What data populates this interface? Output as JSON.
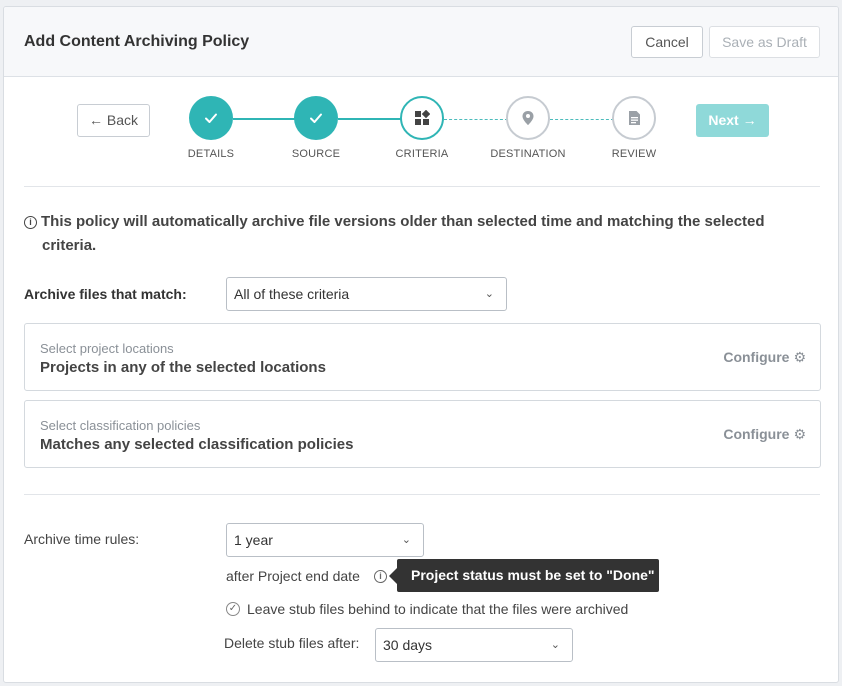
{
  "header": {
    "title": "Add Content Archiving Policy",
    "cancel_label": "Cancel",
    "draft_label": "Save as Draft"
  },
  "wizard": {
    "back_label": "← Back",
    "next_label": "Next →",
    "steps": [
      {
        "label": "DETAILS",
        "state": "done",
        "icon": "check-icon"
      },
      {
        "label": "SOURCE",
        "state": "done",
        "icon": "check-icon"
      },
      {
        "label": "CRITERIA",
        "state": "current",
        "icon": "criteria-icon"
      },
      {
        "label": "DESTINATION",
        "state": "pending",
        "icon": "map-pin-icon"
      },
      {
        "label": "REVIEW",
        "state": "pending",
        "icon": "document-icon"
      }
    ]
  },
  "info": {
    "line1": "This policy will automatically archive file versions older than selected time and matching the selected",
    "line2": "criteria."
  },
  "match": {
    "label": "Archive files that match:",
    "value": "All of these criteria"
  },
  "criteria": [
    {
      "sub": "Select project locations",
      "main": "Projects in any of the selected locations",
      "action": "Configure"
    },
    {
      "sub": "Select classification policies",
      "main": "Matches any selected classification policies",
      "action": "Configure"
    }
  ],
  "time_rules": {
    "label": "Archive time rules:",
    "value": "1 year",
    "after_text": "after Project end date",
    "tooltip": "Project status must be set to \"Done\"",
    "stub_checkbox_label": "Leave stub files behind to indicate that the files were archived",
    "stub_checked": true,
    "delete_label": "Delete stub files after:",
    "delete_value": "30 days"
  },
  "colors": {
    "accent": "#2fb5b5",
    "next_disabled": "#8fd9d9",
    "tooltip_bg": "#333333"
  }
}
